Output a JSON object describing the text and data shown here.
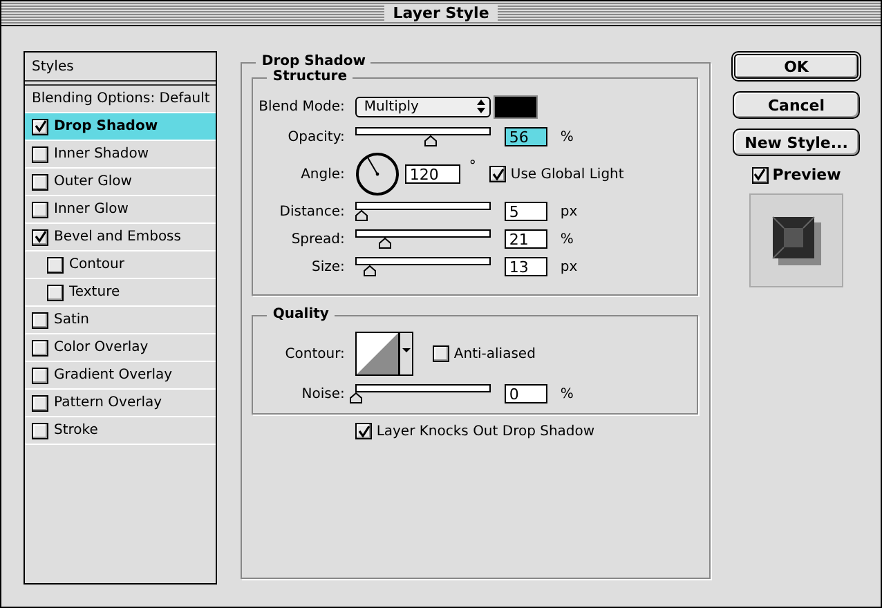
{
  "window": {
    "title": "Layer Style"
  },
  "styles": {
    "header": "Styles",
    "items": [
      {
        "label": "Blending Options: Default",
        "kind": "plain",
        "selected": false
      },
      {
        "label": "Drop Shadow",
        "kind": "check",
        "selected": true,
        "checked": true
      },
      {
        "label": "Inner Shadow",
        "kind": "check",
        "selected": false,
        "checked": false
      },
      {
        "label": "Outer Glow",
        "kind": "check",
        "selected": false,
        "checked": false
      },
      {
        "label": "Inner Glow",
        "kind": "check",
        "selected": false,
        "checked": false
      },
      {
        "label": "Bevel and Emboss",
        "kind": "check",
        "selected": false,
        "checked": true,
        "children": [
          {
            "label": "Contour",
            "kind": "check",
            "selected": false,
            "checked": false
          },
          {
            "label": "Texture",
            "kind": "check",
            "selected": false,
            "checked": false
          }
        ]
      },
      {
        "label": "Satin",
        "kind": "check",
        "selected": false,
        "checked": false
      },
      {
        "label": "Color Overlay",
        "kind": "check",
        "selected": false,
        "checked": false
      },
      {
        "label": "Gradient Overlay",
        "kind": "check",
        "selected": false,
        "checked": false
      },
      {
        "label": "Pattern Overlay",
        "kind": "check",
        "selected": false,
        "checked": false
      },
      {
        "label": "Stroke",
        "kind": "check",
        "selected": false,
        "checked": false
      }
    ]
  },
  "panel": {
    "title": "Drop Shadow",
    "structure": {
      "title": "Structure",
      "blend_mode": {
        "label": "Blend Mode:",
        "value": "Multiply",
        "color": "#000000"
      },
      "opacity": {
        "label": "Opacity:",
        "level": 0.56,
        "value": "56",
        "unit": "%",
        "focused": true
      },
      "angle": {
        "label": "Angle:",
        "value": "120",
        "unit": "°",
        "global_light": {
          "label": "Use Global Light",
          "checked": true
        }
      },
      "sliders": [
        {
          "label": "Distance:",
          "level": 0.04,
          "value": "5",
          "unit": "px",
          "focused": false
        },
        {
          "label": "Spread:",
          "level": 0.21,
          "value": "21",
          "unit": "%",
          "focused": false
        },
        {
          "label": "Size:",
          "level": 0.1,
          "value": "13",
          "unit": "px",
          "focused": false
        }
      ]
    },
    "quality": {
      "title": "Quality",
      "contour": {
        "label": "Contour:",
        "anti_aliased": {
          "label": "Anti-aliased",
          "checked": false
        }
      },
      "noise": {
        "label": "Noise:",
        "level": 0,
        "value": "0",
        "unit": "%",
        "focused": false
      }
    },
    "knockout": {
      "label": "Layer Knocks Out Drop Shadow",
      "checked": true
    }
  },
  "buttons": [
    {
      "label": "OK",
      "default": true
    },
    {
      "label": "Cancel",
      "default": false
    },
    {
      "label": "New Style...",
      "default": false
    }
  ],
  "preview": {
    "label": "Preview",
    "checked": true
  }
}
